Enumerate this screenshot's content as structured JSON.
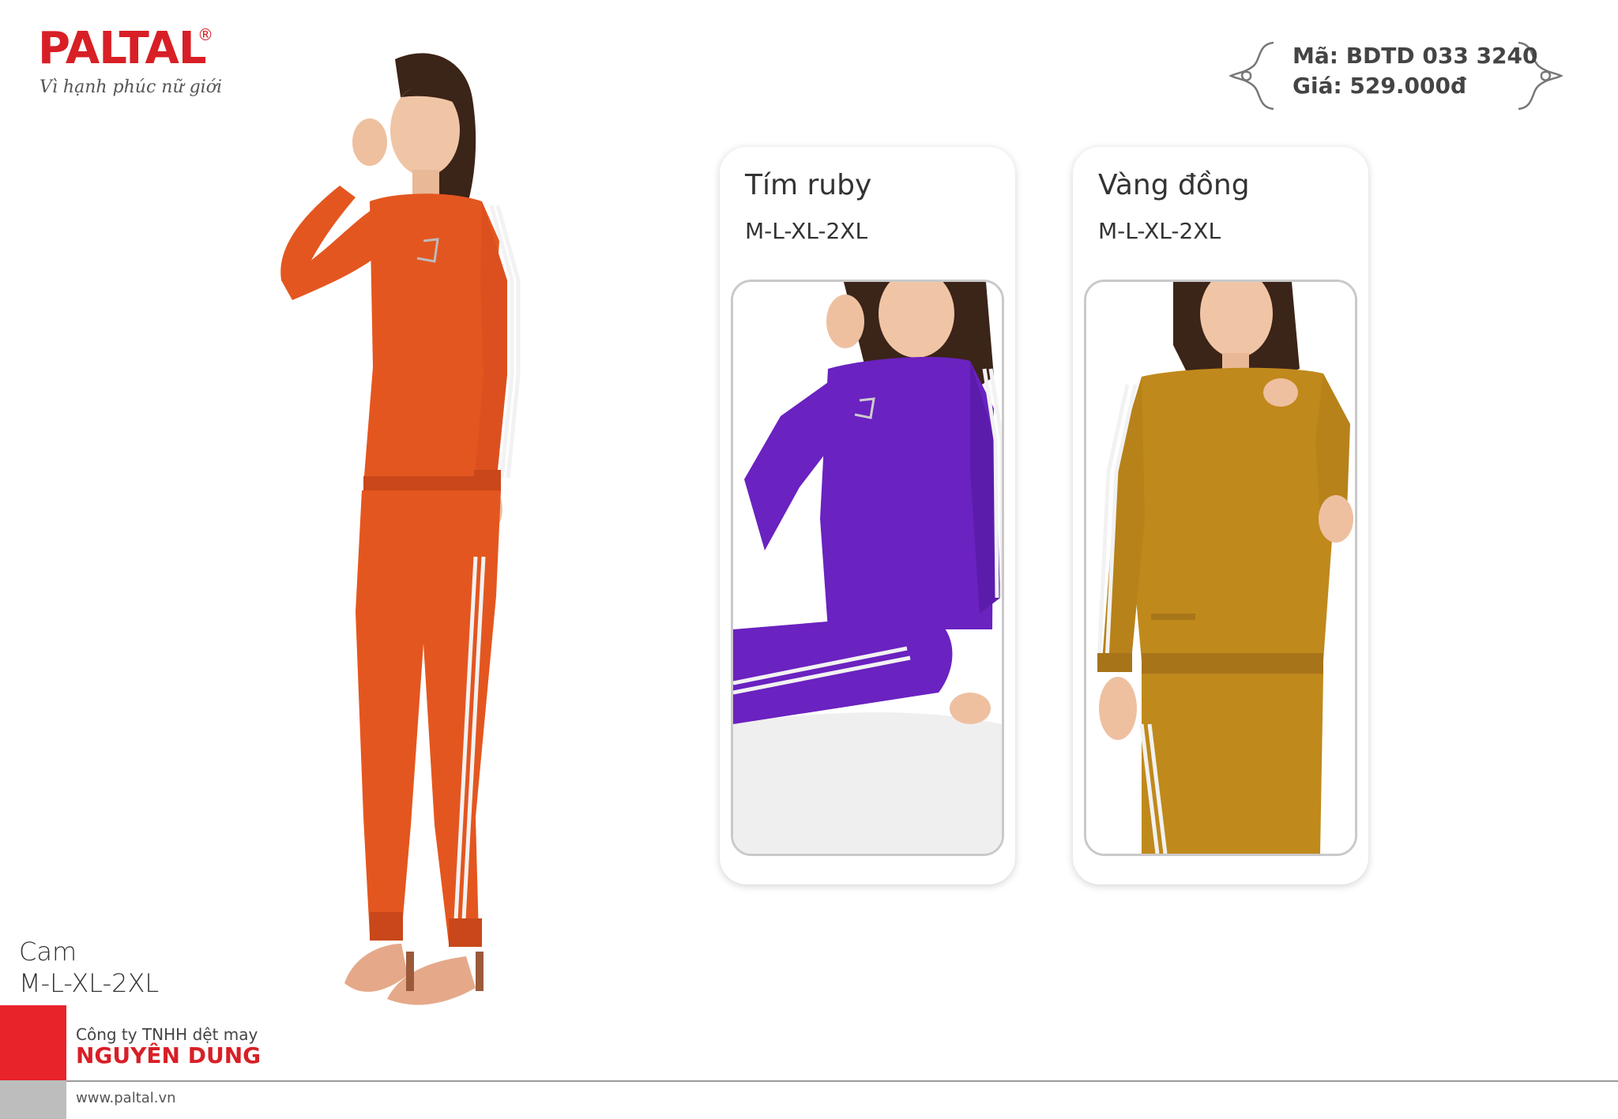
{
  "brand": {
    "name": "PALTAL",
    "registered_mark": "®",
    "tagline": "Vì hạnh phúc nữ giới",
    "color": "#d81f26"
  },
  "product": {
    "code_line": "Mã: BDTD 033 3240",
    "price_line": "Giá: 529.000đ"
  },
  "main_variant": {
    "color_name": "Cam",
    "sizes": "M-L-XL-2XL",
    "swatch": "#e4561f"
  },
  "variants": [
    {
      "color_name": "Tím ruby",
      "sizes": "M-L-XL-2XL",
      "swatch": "#6a22c0"
    },
    {
      "color_name": "Vàng đồng",
      "sizes": "M-L-XL-2XL",
      "swatch": "#c0891c"
    }
  ],
  "footer": {
    "company_prefix": "Công ty TNHH dệt may",
    "company_name": "NGUYÊN DUNG",
    "website": "www.paltal.vn",
    "accent": "#e8232a"
  }
}
